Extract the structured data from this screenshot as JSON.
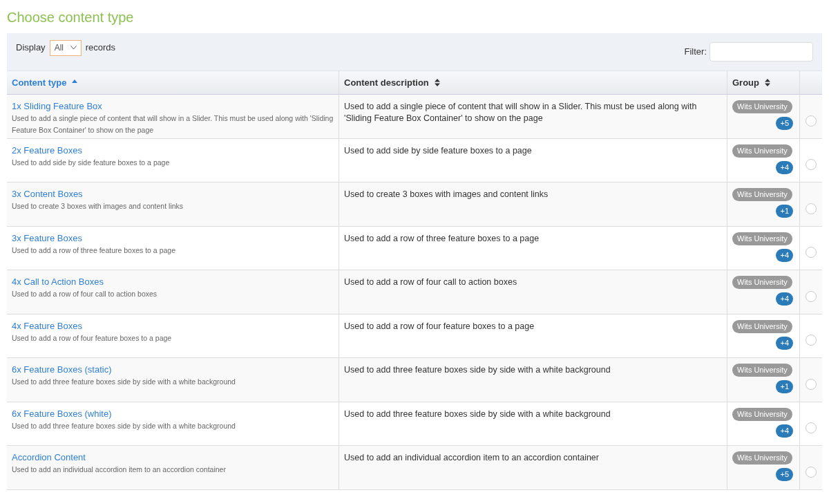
{
  "title": "Choose content type",
  "toolbar": {
    "display_label": "Display",
    "display_value": "All",
    "records_label": "records",
    "filter_label": "Filter:"
  },
  "columns": [
    {
      "label": "Content type",
      "sorted": true
    },
    {
      "label": "Content description",
      "sorted": false
    },
    {
      "label": "Group",
      "sorted": false
    }
  ],
  "rows": [
    {
      "name": "1x Sliding Feature Box",
      "summary": "Used to add a single piece of content that will show in a Slider. This must be used along with 'Sliding Feature Box Container' to show on the page",
      "description": "Used to add a single piece of content that will show in a Slider. This must be used along with 'Sliding Feature Box Container' to show on the page",
      "group": "Wits University",
      "more": "+5",
      "selected": false
    },
    {
      "name": "2x Feature Boxes",
      "summary": "Used to add side by side feature boxes to a page",
      "description": "Used to add side by side feature boxes to a page",
      "group": "Wits University",
      "more": "+4",
      "selected": false
    },
    {
      "name": "3x Content Boxes",
      "summary": "Used to create 3 boxes with images and content links",
      "description": "Used to create 3 boxes with images and content links",
      "group": "Wits University",
      "more": "+1",
      "selected": false
    },
    {
      "name": "3x Feature Boxes",
      "summary": "Used to add a row of three feature boxes to a page",
      "description": "Used to add a row of three feature boxes to a page",
      "group": "Wits University",
      "more": "+4",
      "selected": false
    },
    {
      "name": "4x Call to Action Boxes",
      "summary": "Used to add a row of four call to action boxes",
      "description": "Used to add a row of four call to action boxes",
      "group": "Wits University",
      "more": "+4",
      "selected": false
    },
    {
      "name": "4x Feature Boxes",
      "summary": "Used to add a row of four feature boxes to a page",
      "description": "Used to add a row of four feature boxes to a page",
      "group": "Wits University",
      "more": "+4",
      "selected": false
    },
    {
      "name": "6x Feature Boxes (static)",
      "summary": "Used to add three feature boxes side by side with a white background",
      "description": "Used to add three feature boxes side by side with a white background",
      "group": "Wits University",
      "more": "+1",
      "selected": false
    },
    {
      "name": "6x Feature Boxes (white)",
      "summary": "Used to add three feature boxes side by side with a white background",
      "description": "Used to add three feature boxes side by side with a white background",
      "group": "Wits University",
      "more": "+4",
      "selected": false
    },
    {
      "name": "Accordion Content",
      "summary": "Used to add an individual accordion item to an accordion container",
      "description": "Used to add an individual accordion item to an accordion container",
      "group": "Wits University",
      "more": "+5",
      "selected": false
    }
  ]
}
